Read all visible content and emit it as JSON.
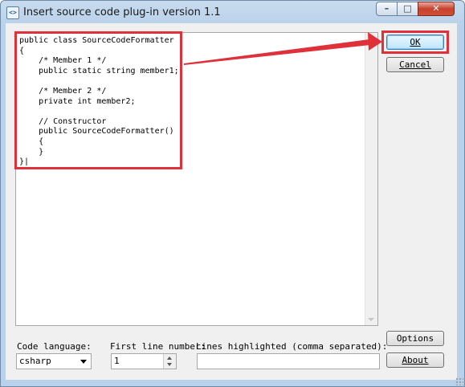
{
  "window": {
    "title": "Insert source code plug-in version 1.1",
    "icon": "code-plugin-icon",
    "controls": {
      "minimize": "–",
      "maximize": "□",
      "close": "✕"
    }
  },
  "editor": {
    "code": "public class SourceCodeFormatter\n{\n    /* Member 1 */\n    public static string member1;\n\n    /* Member 2 */\n    private int member2;\n\n    // Constructor\n    public SourceCodeFormatter()\n    {\n    }\n}|"
  },
  "buttons": {
    "ok": "OK",
    "cancel": "Cancel",
    "options": "Options",
    "about": "About"
  },
  "options_row": {
    "code_language_label": "Code language:",
    "code_language_value": "csharp",
    "first_line_label": "First line number:",
    "first_line_value": "1",
    "lines_highlighted_label": "Lines highlighted (comma separated):",
    "lines_highlighted_value": ""
  },
  "annotation": {
    "color": "#e0303a"
  }
}
